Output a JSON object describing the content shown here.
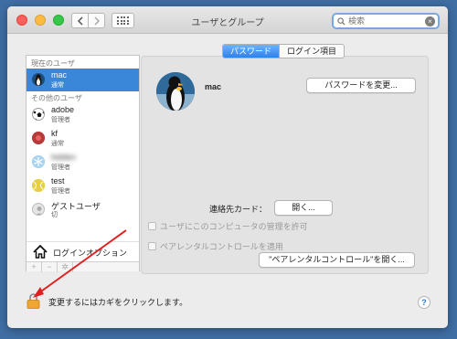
{
  "window": {
    "title": "ユーザとグループ"
  },
  "toolbar": {
    "back_icon": "chevron-left-icon",
    "forward_icon": "chevron-right-icon",
    "grid_icon": "grid-icon"
  },
  "search": {
    "placeholder": "検索",
    "value": "",
    "clear_glyph": "×"
  },
  "sidebar": {
    "current_user_label": "現在のユーザ",
    "current_user": {
      "name": "mac",
      "role": "通常"
    },
    "other_users_label": "その他のユーザ",
    "other_users": [
      {
        "name": "adobe",
        "role": "管理者"
      },
      {
        "name": "kf",
        "role": "通常"
      },
      {
        "name": "hidden",
        "role": "管理者"
      },
      {
        "name": "test",
        "role": "管理者"
      },
      {
        "name": "ゲストユーザ",
        "role": "切"
      }
    ],
    "login_options_label": "ログインオプション",
    "add_glyph": "+",
    "remove_glyph": "−",
    "gear_glyph": "✲"
  },
  "tabs": {
    "password": "パスワード",
    "login_items": "ログイン項目"
  },
  "account": {
    "name": "mac",
    "change_password_button": "パスワードを変更...",
    "contacts_label": "連絡先カード：",
    "open_button": "開く...",
    "allow_admin_label": "ユーザにこのコンピュータの管理を許可",
    "parental_label": "ペアレンタルコントロールを適用",
    "open_parental_button": "\"ペアレンタルコントロール\"を開く..."
  },
  "footer": {
    "lock_text": "変更するにはカギをクリックします。",
    "help_glyph": "?"
  },
  "colors": {
    "desktop": "#3f6ea4",
    "accent": "#3a86d9",
    "annotation_arrow": "#e02020"
  }
}
